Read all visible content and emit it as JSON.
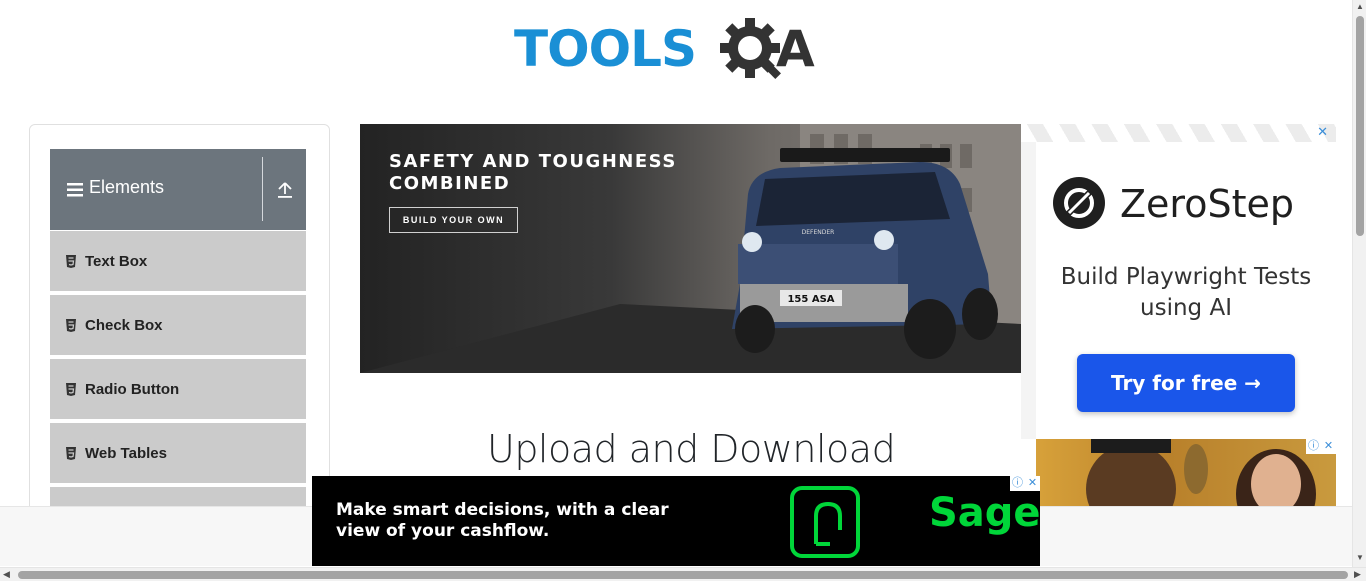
{
  "header": {
    "logo_text_blue": "TOOLS",
    "logo_text_dark": "A",
    "logo_icon": "gear-magnifier-icon"
  },
  "sidebar": {
    "group_title": "Elements",
    "items": [
      {
        "label": "Text Box"
      },
      {
        "label": "Check Box"
      },
      {
        "label": "Radio Button"
      },
      {
        "label": "Web Tables"
      }
    ]
  },
  "main": {
    "page_title": "Upload and Download"
  },
  "ads": {
    "banner": {
      "headline": "SAFETY AND TOUGHNESS COMBINED",
      "cta": "BUILD YOUR OWN",
      "plate": "155 ASA",
      "grille_text": "DEFENDER"
    },
    "side": {
      "brand": "ZeroStep",
      "tagline": "Build Playwright Tests using AI",
      "cta": "Try for free →",
      "close": "✕"
    },
    "bottom": {
      "message": "Make smart decisions, with a clear view of your cashflow.",
      "brand": "Sage"
    }
  },
  "colors": {
    "logo_blue": "#1a8fd5",
    "logo_dark": "#333333",
    "sidebar_header": "#6c757d",
    "menu_item_bg": "#cbcbcb",
    "zerostep_button": "#1a56ea",
    "sage_green": "#00d639"
  }
}
